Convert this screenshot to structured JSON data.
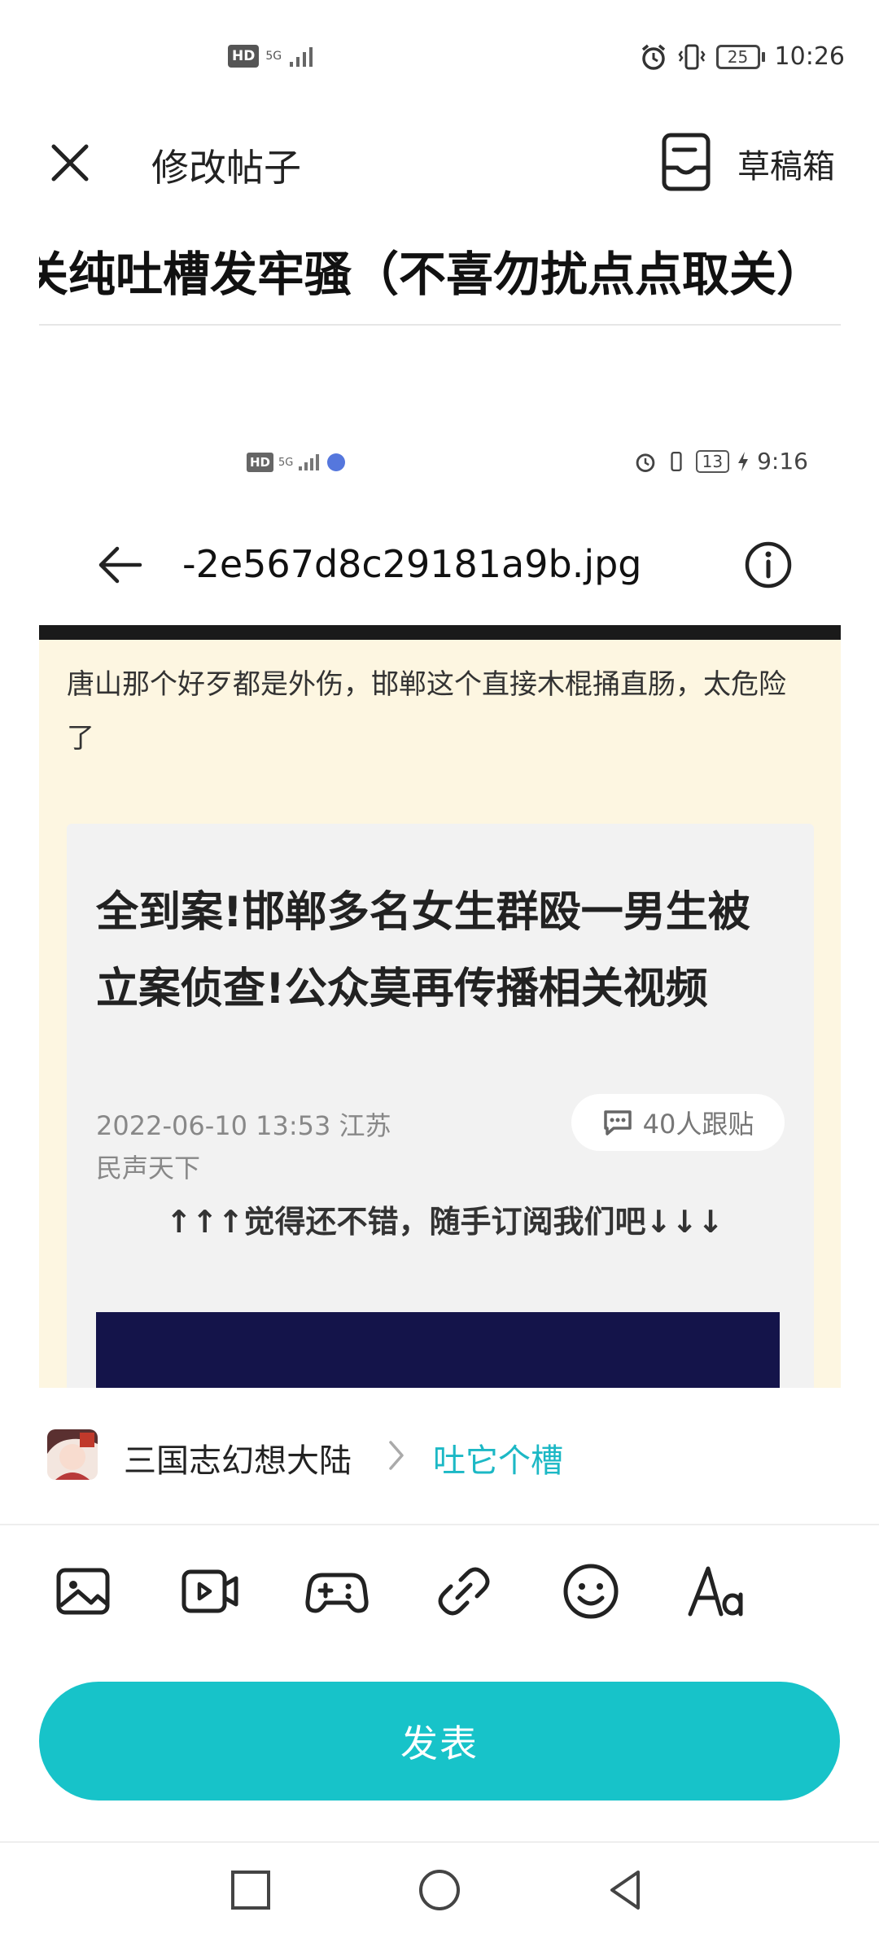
{
  "status_bar": {
    "network_badge": "HD",
    "network_type": "5G",
    "battery": "25",
    "time": "10:26"
  },
  "top_bar": {
    "title": "修改帖子",
    "drafts_label": "草稿箱"
  },
  "post": {
    "title": "关纯吐槽发牢骚（不喜勿扰点点取关）"
  },
  "embedded_image": {
    "status_bar": {
      "network_badge": "HD",
      "network_type": "5G",
      "battery": "13",
      "time": "9:16"
    },
    "filename": "-2e567d8c29181a9b.jpg",
    "comment": "唐山那个好歹都是外伤，邯郸这个直接木棍捅直肠，太危险了",
    "article": {
      "title": "全到案!邯郸多名女生群殴一男生被立案侦查!公众莫再传播相关视频",
      "date_location": "2022-06-10 13:53 江苏",
      "source": "民声天下",
      "follow_count": "40人跟贴",
      "subscribe_text": "↑↑↑觉得还不错，随手订阅我们吧↓↓↓"
    }
  },
  "forum": {
    "name": "三国志幻想大陆",
    "section": "吐它个槽"
  },
  "toolbar": {
    "icons": [
      "image-icon",
      "video-icon",
      "gamepad-icon",
      "link-icon",
      "emoji-icon",
      "text-format-icon"
    ]
  },
  "publish_label": "发表",
  "colors": {
    "accent": "#17c3c9",
    "section_link": "#1cb8c5",
    "embedded_background": "#fdf6e1"
  }
}
